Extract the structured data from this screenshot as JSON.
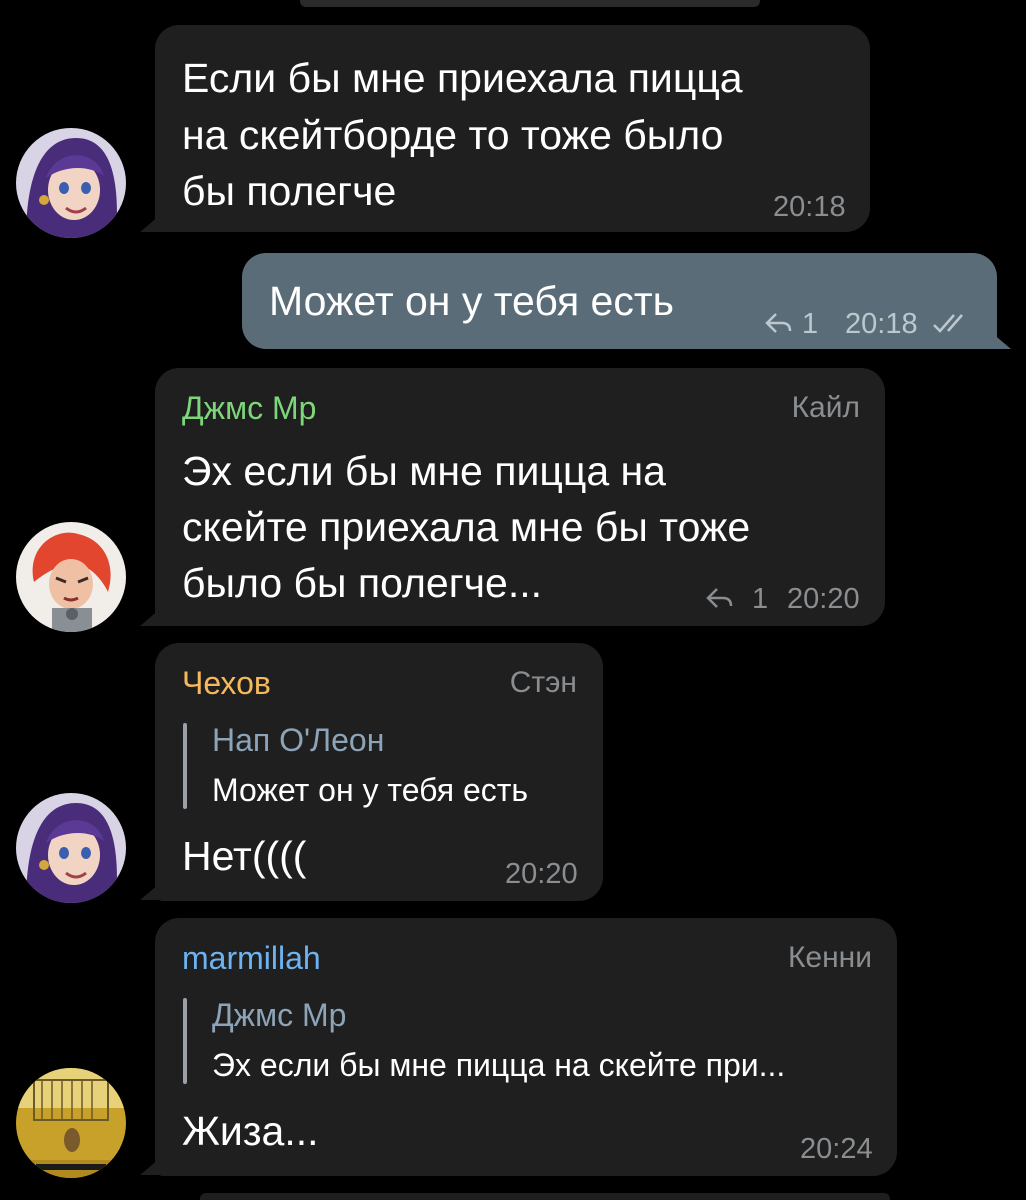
{
  "colors": {
    "background": "#000000",
    "bubble_in": "#1f1f1f",
    "bubble_out": "#5a6c77",
    "meta_gray": "#8a8e91",
    "sender_green": "#7ed67a",
    "sender_orange": "#f5b95c",
    "sender_blue": "#6db3f2"
  },
  "messages": [
    {
      "id": "m1",
      "direction": "in",
      "avatar": "purple-hair-avatar",
      "lines": [
        "Если бы мне приехала пицца",
        "на скейтборде то тоже было",
        "бы полегче"
      ],
      "time": "20:18"
    },
    {
      "id": "m2",
      "direction": "out",
      "text": "Может он у тебя есть",
      "reply_count": "1",
      "time": "20:18",
      "status": "read"
    },
    {
      "id": "m3",
      "direction": "in",
      "avatar": "red-hair-avatar",
      "sender": "Джмс Мр",
      "role": "Кайл",
      "lines": [
        "Эх если бы мне пицца на",
        "скейте приехала мне бы тоже",
        "было бы полегче..."
      ],
      "reply_count": "1",
      "time": "20:20"
    },
    {
      "id": "m4",
      "direction": "in",
      "avatar": "purple-hair-avatar",
      "sender": "Чехов",
      "role": "Стэн",
      "quote": {
        "name": "Нап О'Леон",
        "text": "Может он у тебя есть"
      },
      "text": "Нет((((",
      "time": "20:20"
    },
    {
      "id": "m5",
      "direction": "in",
      "avatar": "yellow-photo-avatar",
      "sender": "marmillah",
      "role": "Кенни",
      "quote": {
        "name": "Джмс Мр",
        "text": "Эх если бы мне пицца на скейте при..."
      },
      "text": "Жиза...",
      "time": "20:24"
    }
  ]
}
